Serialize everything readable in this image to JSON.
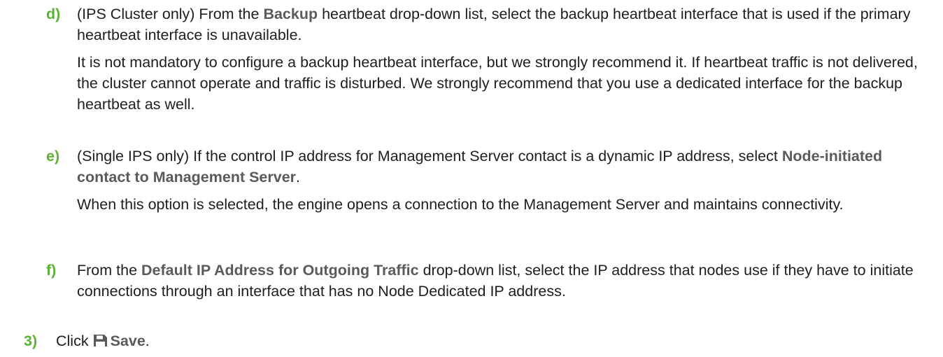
{
  "steps": {
    "d": {
      "marker": "d)",
      "p1_a": "(IPS Cluster only) From the ",
      "p1_ui": "Backup",
      "p1_b": " heartbeat drop-down list, select the backup heartbeat interface that is used if the primary heartbeat interface is unavailable.",
      "p2": "It is not mandatory to configure a backup heartbeat interface, but we strongly recommend it. If heartbeat traffic is not delivered, the cluster cannot operate and traffic is disturbed. We strongly recommend that you use a dedicated interface for the backup heartbeat as well."
    },
    "e": {
      "marker": "e)",
      "p1_a": "(Single IPS only) If the control IP address for Management Server contact is a dynamic IP address, select ",
      "p1_ui": "Node-initiated contact to Management Server",
      "p1_b": ".",
      "p2": "When this option is selected, the engine opens a connection to the Management Server and maintains connectivity."
    },
    "f": {
      "marker": "f)",
      "p1_a": "From the ",
      "p1_ui": "Default IP Address for Outgoing Traffic",
      "p1_b": " drop-down list, select the IP address that nodes use if they have to initiate connections through an interface that has no Node Dedicated IP address."
    },
    "s3": {
      "marker": "3)",
      "text_a": "Click ",
      "icon": "save-icon",
      "ui": "Save",
      "text_b": "."
    }
  },
  "colors": {
    "marker": "#5cb332",
    "ui_label": "#5a5a5a",
    "text": "#1e1e1e"
  }
}
